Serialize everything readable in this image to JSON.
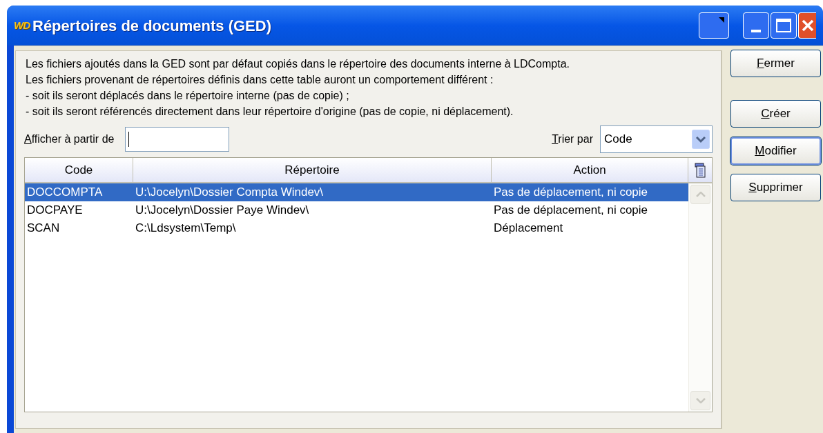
{
  "window": {
    "logo": "WD",
    "title": "Répertoires de documents (GED)"
  },
  "description": [
    "Les fichiers ajoutés dans la GED sont par défaut copiés dans le répertoire des documents interne à LDCompta.",
    "Les fichiers provenant de répertoires définis dans cette table auront un comportement différent :",
    "- soit ils seront déplacés dans le répertoire interne (pas de copie) ;",
    "- soit ils seront référencés directement dans leur répertoire d'origine (pas de copie, ni déplacement)."
  ],
  "filter": {
    "label": "Afficher à partir de"
  },
  "sort": {
    "label": "Trier par",
    "value": "Code"
  },
  "table": {
    "columns": [
      "Code",
      "Répertoire",
      "Action"
    ],
    "rows": [
      {
        "cells": [
          "DOCCOMPTA",
          "U:\\Jocelyn\\Dossier Compta Windev\\",
          "Pas de déplacement, ni copie"
        ],
        "selected": true
      },
      {
        "cells": [
          "DOCPAYE",
          "U:\\Jocelyn\\Dossier Paye Windev\\",
          "Pas de déplacement, ni copie"
        ],
        "selected": false
      },
      {
        "cells": [
          "SCAN",
          "C:\\Ldsystem\\Temp\\",
          "Déplacement"
        ],
        "selected": false
      }
    ]
  },
  "buttons": [
    {
      "label": "Fermer",
      "focused": false
    },
    {
      "label": "Créer",
      "focused": false
    },
    {
      "label": "Modifier",
      "focused": true
    },
    {
      "label": "Supprimer",
      "focused": false
    }
  ]
}
